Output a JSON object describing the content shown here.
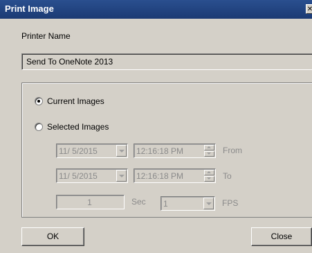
{
  "window": {
    "title": "Print Image",
    "close_glyph": "✕"
  },
  "printer": {
    "label": "Printer Name",
    "selected": "Send To OneNote 2013"
  },
  "options": {
    "current_images": {
      "label": "Current Images",
      "checked": true
    },
    "selected_images": {
      "label": "Selected Images",
      "checked": false
    }
  },
  "range": {
    "from": {
      "date": "11/ 5/2015",
      "time": "12:16:18 PM",
      "label": "From"
    },
    "to": {
      "date": "11/ 5/2015",
      "time": "12:16:18 PM",
      "label": "To"
    }
  },
  "interval": {
    "value": "1",
    "unit": "Sec",
    "fps_value": "1",
    "fps_label": "FPS"
  },
  "buttons": {
    "ok": "OK",
    "close": "Close"
  },
  "colors": {
    "titlebar": "#1b3a73",
    "dialog_bg": "#d4d0c8",
    "disabled_text": "#8a8a8a"
  }
}
